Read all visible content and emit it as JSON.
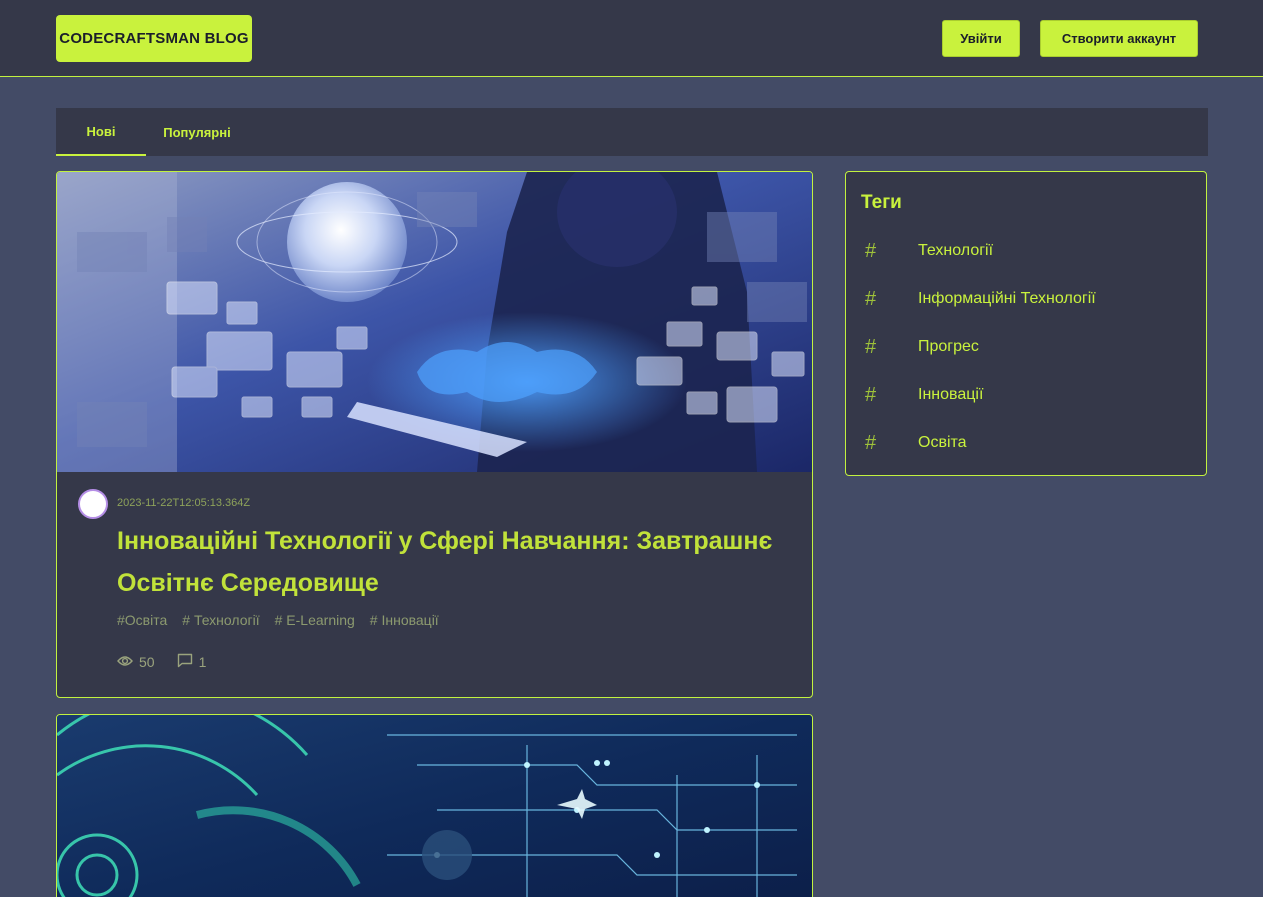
{
  "header": {
    "logo": "CODECRAFTSMAN BLOG",
    "login_label": "Увійти",
    "signup_label": "Створити аккаунт"
  },
  "tabs": [
    {
      "label": "Нові",
      "active": true
    },
    {
      "label": "Популярні",
      "active": false
    }
  ],
  "posts": [
    {
      "date": "2023-11-22T12:05:13.364Z",
      "title": "Інноваційні Технології у Сфері Навчання: Завтрашнє Освітнє Середовище",
      "tags": [
        "#Освіта",
        "# Технології",
        "# E-Learning",
        "# Інновації"
      ],
      "views": "50",
      "comments": "1"
    }
  ],
  "sidebar": {
    "title": "Теги",
    "tags": [
      {
        "label": "Технології",
        "icon": "hash-icon"
      },
      {
        "label": "Інформаційні Технології",
        "icon": "hash-icon"
      },
      {
        "label": "Прогрес",
        "icon": "hash-icon"
      },
      {
        "label": "Інновації",
        "icon": "hash-icon"
      },
      {
        "label": "Освіта",
        "icon": "hash-icon"
      }
    ]
  },
  "colors": {
    "accent": "#c9f23d",
    "background": "#434b66",
    "panel": "#353849"
  }
}
